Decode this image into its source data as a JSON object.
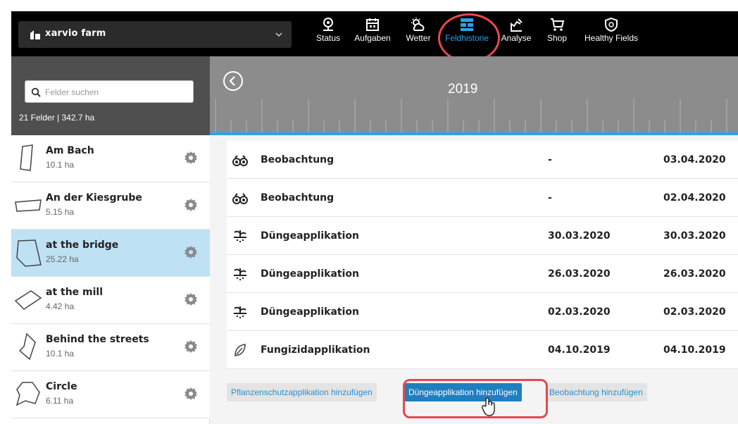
{
  "farm": {
    "name": "xarvio farm"
  },
  "nav": [
    {
      "label": "Status",
      "icon": "map-pin-icon"
    },
    {
      "label": "Aufgaben",
      "icon": "calendar-icon"
    },
    {
      "label": "Wetter",
      "icon": "weather-icon"
    },
    {
      "label": "Feldhistorie",
      "icon": "field-history-icon",
      "active": true
    },
    {
      "label": "Analyse",
      "icon": "analysis-icon"
    },
    {
      "label": "Shop",
      "icon": "cart-icon"
    },
    {
      "label": "Healthy Fields",
      "icon": "shield-icon"
    }
  ],
  "sidebar": {
    "search_placeholder": "Felder suchen",
    "summary": "21 Felder | 342.7 ha",
    "fields": [
      {
        "name": "Am Bach",
        "size": "10.1 ha"
      },
      {
        "name": "An der Kiesgrube",
        "size": "5.15 ha"
      },
      {
        "name": "at the bridge",
        "size": "25.22 ha",
        "selected": true
      },
      {
        "name": "at the mill",
        "size": "4.42 ha"
      },
      {
        "name": "Behind the streets",
        "size": "10.1 ha"
      },
      {
        "name": "Circle",
        "size": "6.11 ha"
      }
    ]
  },
  "timeline": {
    "year": "2019"
  },
  "history": [
    {
      "type": "Beobachtung",
      "icon": "binoculars-icon",
      "start": "-",
      "end": "03.04.2020"
    },
    {
      "type": "Beobachtung",
      "icon": "binoculars-icon",
      "start": "-",
      "end": "02.04.2020"
    },
    {
      "type": "Düngeapplikation",
      "icon": "fertilizer-icon",
      "start": "30.03.2020",
      "end": "30.03.2020"
    },
    {
      "type": "Düngeapplikation",
      "icon": "fertilizer-icon",
      "start": "26.03.2020",
      "end": "26.03.2020"
    },
    {
      "type": "Düngeapplikation",
      "icon": "fertilizer-icon",
      "start": "02.03.2020",
      "end": "02.03.2020"
    },
    {
      "type": "Fungizidapplikation",
      "icon": "leaf-icon",
      "start": "04.10.2019",
      "end": "04.10.2019"
    }
  ],
  "actions": {
    "add_protection": "Pflanzenschutzapplikation hinzufügen",
    "add_fertilizer": "Düngeapplikation hinzufügen",
    "add_observation": "Beobachtung hinzufügen"
  },
  "colors": {
    "accent": "#2aa3e6",
    "selected_row": "#bfe1f4",
    "highlight_ring": "#e8474f",
    "primary_button": "#1f7fbf"
  }
}
